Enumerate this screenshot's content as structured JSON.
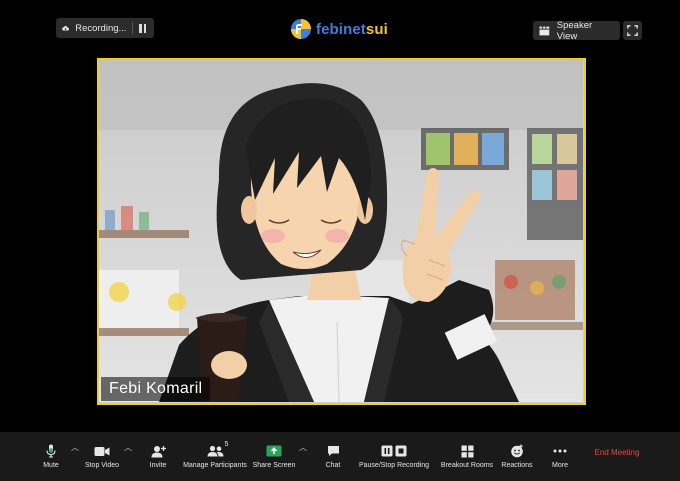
{
  "top_bar": {
    "recording_label": "Recording...",
    "brand": {
      "part1": "febi",
      "part2": "net",
      "part3": "sui"
    },
    "speaker_view_label": "Speaker View"
  },
  "video": {
    "participant_name": "Febi Komaril"
  },
  "toolbar": {
    "mute_label": "Mute",
    "stop_video_label": "Stop Video",
    "invite_label": "Invite",
    "participants_label": "Manage Participants",
    "participants_count": "5",
    "share_screen_label": "Share Screen",
    "chat_label": "Chat",
    "recording_label": "Pause/Stop Recording",
    "breakout_label": "Breakout Rooms",
    "reactions_label": "Reactions",
    "more_label": "More",
    "end_label": "End Meeting"
  },
  "colors": {
    "active_border": "#f1cf1d",
    "share_green": "#26a65b",
    "end_red": "#e54a3b",
    "brand_blue": "#3f7fdc",
    "brand_yellow": "#f3c431"
  },
  "icons": [
    "cloud-icon",
    "pause-icon",
    "logo-icon",
    "speaker-view-icon",
    "fullscreen-icon",
    "mic-icon",
    "video-camera-icon",
    "invite-icon",
    "participants-icon",
    "share-screen-icon",
    "chat-icon",
    "recording-icon",
    "breakout-rooms-icon",
    "reactions-icon",
    "more-icon"
  ]
}
